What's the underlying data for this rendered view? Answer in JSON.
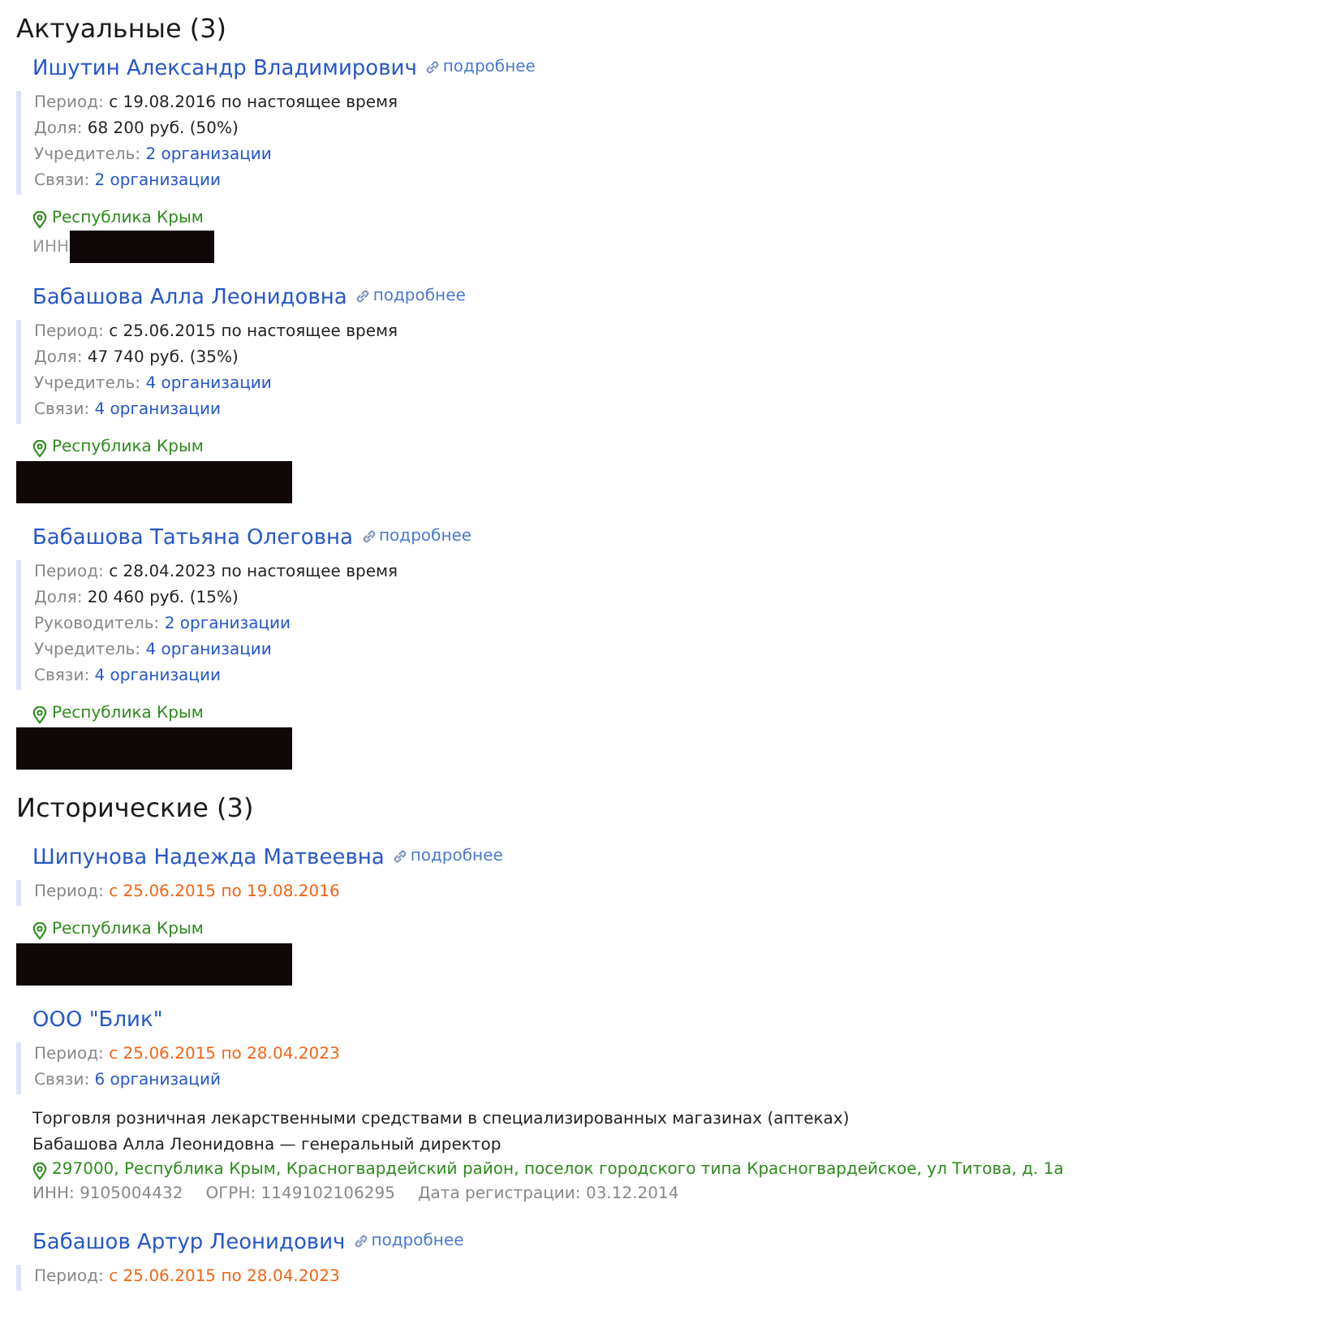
{
  "sections": [
    {
      "title": "Актуальные (3)",
      "items": [
        {
          "kind": "person",
          "name": "Ишутин Александр Владимирович",
          "more": "подробнее",
          "details": [
            {
              "label": "Период:",
              "value": "с 19.08.2016 по настоящее время",
              "kind": "text"
            },
            {
              "label": "Доля:",
              "value": "68 200 руб. (50%)",
              "kind": "text"
            },
            {
              "label": "Учредитель:",
              "value": "2 организации",
              "kind": "link"
            },
            {
              "label": "Связи:",
              "value": "2 организации",
              "kind": "link"
            }
          ],
          "region": "Республика Крым",
          "inn_label": "ИНН",
          "redacted": true
        },
        {
          "kind": "person",
          "name": "Бабашова Алла Леонидовна",
          "more": "подробнее",
          "details": [
            {
              "label": "Период:",
              "value": "с 25.06.2015 по настоящее время",
              "kind": "text"
            },
            {
              "label": "Доля:",
              "value": "47 740 руб. (35%)",
              "kind": "text"
            },
            {
              "label": "Учредитель:",
              "value": "4 организации",
              "kind": "link"
            },
            {
              "label": "Связи:",
              "value": "4 организации",
              "kind": "link"
            }
          ],
          "region": "Республика Крым",
          "redacted": true
        },
        {
          "kind": "person",
          "name": "Бабашова Татьяна Олеговна",
          "more": "подробнее",
          "details": [
            {
              "label": "Период:",
              "value": "с 28.04.2023 по настоящее время",
              "kind": "text"
            },
            {
              "label": "Доля:",
              "value": "20 460 руб. (15%)",
              "kind": "text"
            },
            {
              "label": "Руководитель:",
              "value": "2 организации",
              "kind": "link"
            },
            {
              "label": "Учредитель:",
              "value": "4 организации",
              "kind": "link"
            },
            {
              "label": "Связи:",
              "value": "4 организации",
              "kind": "link"
            }
          ],
          "region": "Республика Крым",
          "redacted": true
        }
      ]
    },
    {
      "title": "Исторические (3)",
      "items": [
        {
          "kind": "person",
          "name": "Шипунова Надежда Матвеевна",
          "more": "подробнее",
          "details": [
            {
              "label": "Период:",
              "value": "с 25.06.2015 по 19.08.2016",
              "kind": "ended"
            }
          ],
          "region": "Республика Крым",
          "redacted": true
        },
        {
          "kind": "company",
          "name": "ООО \"Блик\"",
          "details": [
            {
              "label": "Период:",
              "value": "с 25.06.2015 по 28.04.2023",
              "kind": "ended"
            },
            {
              "label": "Связи:",
              "value": "6 организаций",
              "kind": "link"
            }
          ],
          "activity": "Торговля розничная лекарственными средствами в специализированных магазинах (аптеках)",
          "director": "Бабашова Алла Леонидовна — генеральный директор",
          "address": "297000, Республика Крым, Красногвардейский район, поселок городского типа Красногвардейское, ул Титова, д. 1а",
          "codes": [
            "ИНН: 9105004432",
            "ОГРН: 1149102106295",
            "Дата регистрации: 03.12.2014"
          ]
        },
        {
          "kind": "person",
          "name": "Бабашов Артур Леонидович",
          "more": "подробнее",
          "details": [
            {
              "label": "Период:",
              "value": "с 25.06.2015 по 28.04.2023",
              "kind": "ended"
            }
          ]
        }
      ]
    }
  ]
}
